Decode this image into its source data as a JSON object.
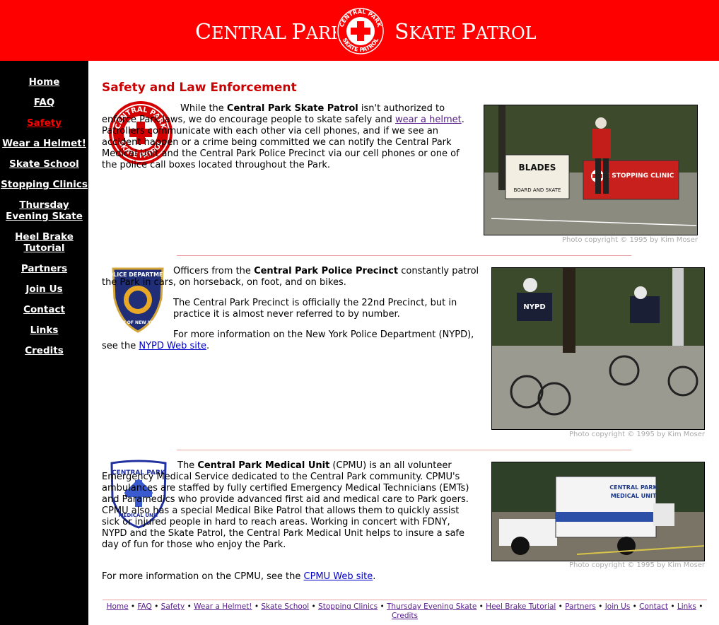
{
  "header": {
    "left_cap1": "C",
    "left_rest1": "ENTRAL ",
    "left_cap2": "P",
    "left_rest2": "ARK",
    "right_cap1": "S",
    "right_rest1": "KATE ",
    "right_cap2": "P",
    "right_rest2": "ATROL",
    "logo_top": "CENTRAL PARK",
    "logo_bottom": "SKATE PATROL"
  },
  "sidebar": {
    "items": [
      {
        "label": "Home"
      },
      {
        "label": "FAQ"
      },
      {
        "label": "Safety"
      },
      {
        "label": "Wear a Helmet!"
      },
      {
        "label": "Skate School"
      },
      {
        "label": "Stopping Clinics"
      },
      {
        "label": "Thursday",
        "label2": "Evening Skate"
      },
      {
        "label": "Heel Brake",
        "label2": "Tutorial"
      },
      {
        "label": "Partners"
      },
      {
        "label": "Join Us"
      },
      {
        "label": "Contact"
      },
      {
        "label": "Links"
      },
      {
        "label": "Credits"
      }
    ]
  },
  "main": {
    "title": "Safety and Law Enforcement",
    "s1": {
      "t1": "While the ",
      "b1": "Central Park Skate Patrol",
      "t2": " isn't authorized to enforce Park laws, we do encourage people to skate safely and ",
      "link": "wear a helmet",
      "t3": ". Patrollers communicate with each other via cell phones, and if we see an accident happen or a crime being committed we can notify the Central Park Medical Unit and the Central Park Police Precinct via our cell phones or one of the police call boxes located throughout the Park.",
      "credit": "Photo copyright © 1995 by Kim Moser",
      "photo_sign1": "BLADES",
      "photo_sign1b": "BOARD AND SKATE",
      "photo_sign2": "FREE STOPPING CLINIC"
    },
    "s2": {
      "t1": "Officers from the ",
      "b1": "Central Park Police Precinct",
      "t2": " constantly patrol the Park in cars, on horseback, on foot, and on bikes.",
      "p2": "The Central Park Precinct is officially the 22nd Precinct, but in practice it is almost never referred to by number.",
      "p3a": "For more information on the New York Police Department (NYPD), see the ",
      "link": "NYPD Web site",
      "p3b": ".",
      "credit": "Photo copyright © 1995 by Kim Moser",
      "badge_top": "POLICE DEPARTMENT",
      "badge_bottom": "CITY OF NEW YORK",
      "shirt": "NYPD"
    },
    "s3": {
      "t1": "The ",
      "b1": "Central Park Medical Unit",
      "t2": " (CPMU) is an all volunteer Emergency Medical Service dedicated to the Central Park community. CPMU's ambulances are staffed by fully certified Emergency Medical Technicians (EMTs) and Paramedics who provide advanced first aid and medical care to Park goers. CPMU also has a special Medical Bike Patrol that allows them to quickly assist sick or injured people in hard to reach areas. Working in concert with FDNY, NYPD and the Skate Patrol, the Central Park Medical Unit helps to insure a safe day of fun for those who enjoy the Park.",
      "p2a": "For more information on the CPMU, see the ",
      "link": "CPMU Web site",
      "p2b": ".",
      "credit": "Photo copyright © 1995 by Kim Moser",
      "badge_top": "CENTRAL PARK",
      "badge_bottom": "MEDICAL UNIT",
      "amb_text1": "CENTRAL PARK",
      "amb_text2": "MEDICAL UNIT"
    }
  },
  "footer": {
    "links": [
      "Home",
      "FAQ",
      "Safety",
      "Wear a Helmet!",
      "Skate School",
      "Stopping Clinics",
      "Thursday Evening Skate",
      "Heel Brake Tutorial",
      "Partners",
      "Join Us",
      "Contact",
      "Links",
      "Credits"
    ],
    "sep": " • "
  },
  "colors": {
    "header_bg": "#ff0000",
    "sidebar_bg": "#000000",
    "title": "#cc0000",
    "active_nav": "#ff0000"
  }
}
